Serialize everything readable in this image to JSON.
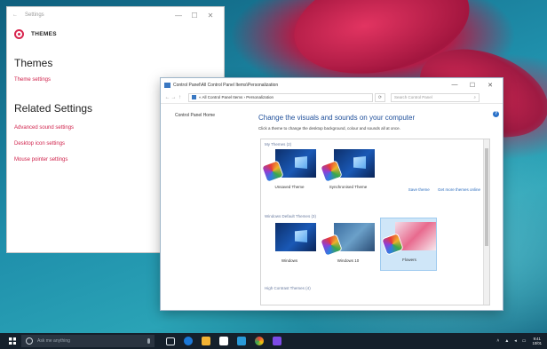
{
  "settings_window": {
    "title": "Settings",
    "back_symbol": "←",
    "controls": [
      "—",
      "☐",
      "✕"
    ],
    "header_label": "THEMES",
    "section_themes": "Themes",
    "theme_settings_link": "Theme settings",
    "section_related": "Related Settings",
    "related_links": [
      "Advanced sound settings",
      "Desktop icon settings",
      "Mouse pointer settings"
    ]
  },
  "control_panel": {
    "title": "Control Panel\\All Control Panel Items\\Personalization",
    "controls": [
      "—",
      "☐",
      "✕"
    ],
    "nav": [
      "←",
      "→",
      "↑"
    ],
    "breadcrumb": "« All Control Panel Items › Personalization",
    "search_placeholder": "Search Control Panel",
    "left_link": "Control Panel Home",
    "heading": "Change the visuals and sounds on your computer",
    "description": "Click a theme to change the desktop background, colour and sounds all at once.",
    "my_themes_label": "My Themes (2)",
    "my_themes": [
      "Unsaved Theme",
      "Synchronised Theme"
    ],
    "save_theme_link": "Save theme",
    "get_more_link": "Get more themes online",
    "default_themes_label": "Windows Default Themes (3)",
    "default_themes": [
      "Windows",
      "Windows 10",
      "Flowers"
    ],
    "high_contrast_label": "High Contrast Themes (4)"
  },
  "taskbar": {
    "search_placeholder": "Ask me anything",
    "icon_colors": [
      "#1b78d7",
      "#f2b233",
      "#2a9ad8",
      "#ffffff",
      "#1e90ff",
      "#e8613c",
      "#7d4be6"
    ],
    "clock_time": "9:41",
    "clock_date": "10/01"
  },
  "colors": {
    "accent": "#d0244d",
    "link_blue": "#2f6fbf",
    "heading_blue": "#1f4f9a"
  }
}
